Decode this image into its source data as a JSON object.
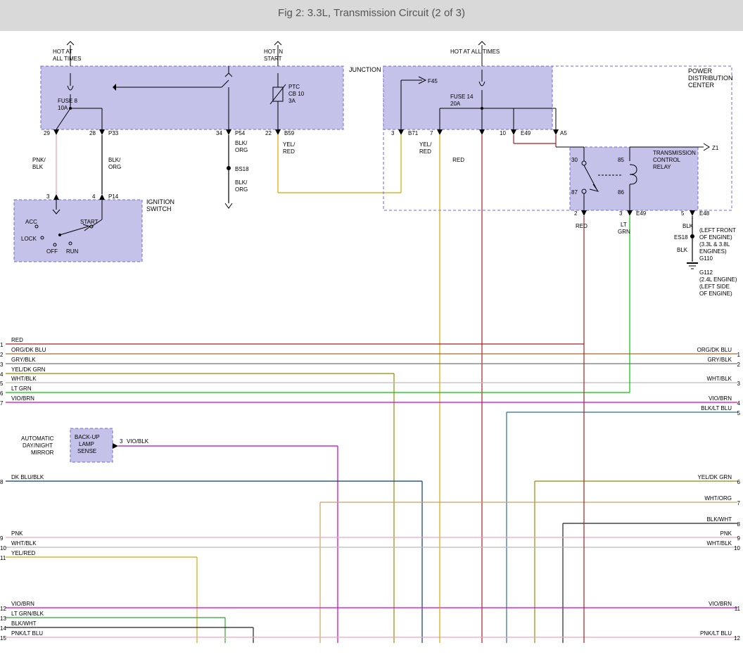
{
  "title": "Fig 2: 3.3L, Transmission Circuit (2 of 3)",
  "components": {
    "junction_block": {
      "label": "JUNCTION BLOCK",
      "hot_at_all_times": "HOT AT ALL TIMES",
      "hot_in_start": "HOT IN START",
      "fuse8": "FUSE 8",
      "fuse8_amps": "10A",
      "ptc": "PTC",
      "cb10": "CB 10",
      "cb_amps": "3A",
      "pin29": "29",
      "pin28": "28",
      "pin34": "34",
      "pin22": "22",
      "p33": "P33",
      "p54": "P54",
      "b59": "B59"
    },
    "pdc": {
      "label_l1": "POWER",
      "label_l2": "DISTRIBUTION",
      "label_l3": "CENTER",
      "hot": "HOT AT ALL TIMES",
      "f45": "F45",
      "fuse14": "FUSE 14",
      "fuse14_amps": "20A",
      "relay_label_l1": "TRANSMISSION",
      "relay_label_l2": "CONTROL",
      "relay_label_l3": "RELAY",
      "z1": "Z1",
      "pin3": "3",
      "b71": "B71",
      "pin7": "7",
      "pin10": "10",
      "e49": "E49",
      "a5": "A5",
      "r30": "30",
      "r85": "85",
      "r86": "86",
      "r87": "87",
      "pin2": "2",
      "red": "RED",
      "pin3b": "3",
      "ltgrn": "LT GRN",
      "e49b": "E49",
      "pin5": "5",
      "e48": "E48",
      "blk": "BLK",
      "es18": "ES18",
      "ground_note_l1": "(LEFT FRONT",
      "ground_note_l2": "OF ENGINE)",
      "ground_note_l3": "(3.3L & 3.8L",
      "ground_note_l4": "ENGINES)",
      "ground_note_l5": "G110",
      "ground_note_l6": "G112",
      "ground_note_l7": "(2.4L ENGINE)",
      "ground_note_l8": "(LEFT SIDE",
      "ground_note_l9": "OF ENGINE)"
    },
    "ignition_switch": {
      "label_l1": "IGNITION",
      "label_l2": "SWITCH",
      "acc": "ACC",
      "lock": "LOCK",
      "off": "OFF",
      "run": "RUN",
      "start": "START",
      "pin3": "3",
      "pin4": "4",
      "p14": "P14"
    },
    "mirror": {
      "l1": "AUTOMATIC",
      "l2": "DAY/NIGHT",
      "l3": "MIRROR",
      "backup_l1": "BACK-UP",
      "backup_l2": "LAMP",
      "backup_l3": "SENSE",
      "pin3": "3",
      "wire": "VIO/BLK"
    },
    "splices": {
      "bs18": "BS18",
      "blkorg1": "BLK/ ORG",
      "blkorg2": "BLK/ ORG"
    }
  },
  "colors": {
    "pnkblk": "PNK/ BLK",
    "blkorg": "BLK/ ORG",
    "yelred": "YEL/ RED",
    "red": "RED"
  },
  "left_wires": {
    "1": {
      "n": "1",
      "c": "RED"
    },
    "2": {
      "n": "2",
      "c": "ORG/DK BLU"
    },
    "3": {
      "n": "3",
      "c": "GRY/BLK"
    },
    "4": {
      "n": "4",
      "c": "YEL/DK GRN"
    },
    "5": {
      "n": "5",
      "c": "WHT/BLK"
    },
    "6": {
      "n": "6",
      "c": "LT GRN"
    },
    "7": {
      "n": "7",
      "c": "VIO/BRN"
    },
    "8": {
      "n": "8",
      "c": "DK BLU/BLK"
    },
    "9": {
      "n": "9",
      "c": "PNK"
    },
    "10": {
      "n": "10",
      "c": "WHT/BLK"
    },
    "11": {
      "n": "11",
      "c": "YEL/RED"
    },
    "12": {
      "n": "12",
      "c": "VIO/BRN"
    },
    "13": {
      "n": "13",
      "c": "LT GRN/BLK"
    },
    "14": {
      "n": "14",
      "c": "BLK/WHT"
    },
    "15": {
      "n": "15",
      "c": "PNK/LT BLU"
    }
  },
  "right_wires": {
    "1": {
      "n": "1",
      "c": "ORG/DK BLU"
    },
    "2": {
      "n": "2",
      "c": "GRY/BLK"
    },
    "3": {
      "n": "3",
      "c": "WHT/BLK"
    },
    "4": {
      "n": "4",
      "c": "VIO/BRN"
    },
    "5": {
      "n": "5",
      "c": "BLK/LT BLU"
    },
    "6": {
      "n": "6",
      "c": "YEL/DK GRN"
    },
    "7": {
      "n": "7",
      "c": "WHT/ORG"
    },
    "8": {
      "n": "8",
      "c": "BLK/WHT"
    },
    "9": {
      "n": "9",
      "c": "PNK"
    },
    "10": {
      "n": "10",
      "c": "WHT/BLK"
    },
    "11": {
      "n": "11",
      "c": "VIO/BRN"
    },
    "12": {
      "n": "12",
      "c": "PNK/LT BLU"
    }
  },
  "wire_colors": {
    "red": "#a82020",
    "blkorg": "#000",
    "pnkblk": "#e79bb3",
    "yelred": "#d6a800",
    "orgdkblu": "#a86a2a",
    "gryblk": "#777",
    "yeldkgrn": "#928a00",
    "whtblk": "#bbb",
    "ltgrn": "#00c800",
    "viobrn": "#d800d8",
    "dkblublk": "#003a80",
    "pnk": "#f5a0c0",
    "blkltblu": "#2a6aa8",
    "blkwht": "#222",
    "pnkltblu": "#f5a0c0",
    "ltgrnblk": "#2aa82a",
    "whtorg": "#d0a060",
    "blk": "#000"
  }
}
